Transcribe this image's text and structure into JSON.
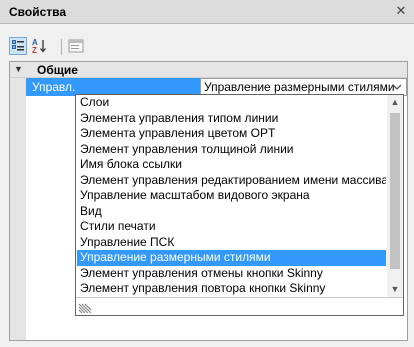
{
  "panel": {
    "title": "Свойства",
    "close_glyph": "✕"
  },
  "toolbar": {
    "buttons": [
      {
        "icon": "categorized-view-icon",
        "active": true
      },
      {
        "icon": "sort-alphabetical-icon",
        "active": false
      },
      {
        "icon": "property-pages-icon",
        "active": false
      }
    ]
  },
  "group": {
    "label": "Общие",
    "expanded": true
  },
  "property": {
    "name": "Управл.",
    "value": "Управление размерными стилями"
  },
  "dropdown": {
    "items": [
      "Слои",
      "Элемента управления типом линии",
      "Элемента управления цветом OPT",
      "Элемент управления толщиной линии",
      "Имя блока ссылки",
      "Элемент управления редактированием имени массива",
      "Управление масштабом видового экрана",
      "Вид",
      "Стили печати",
      "Управление ПСК",
      "Управление размерными стилями",
      "Элемент управления отмены кнопки Skinny",
      "Элемент управления повтора кнопки Skinny"
    ],
    "selected_index": 10
  },
  "colors": {
    "selection": "#3399ff",
    "panel": "#f0f0f0"
  }
}
